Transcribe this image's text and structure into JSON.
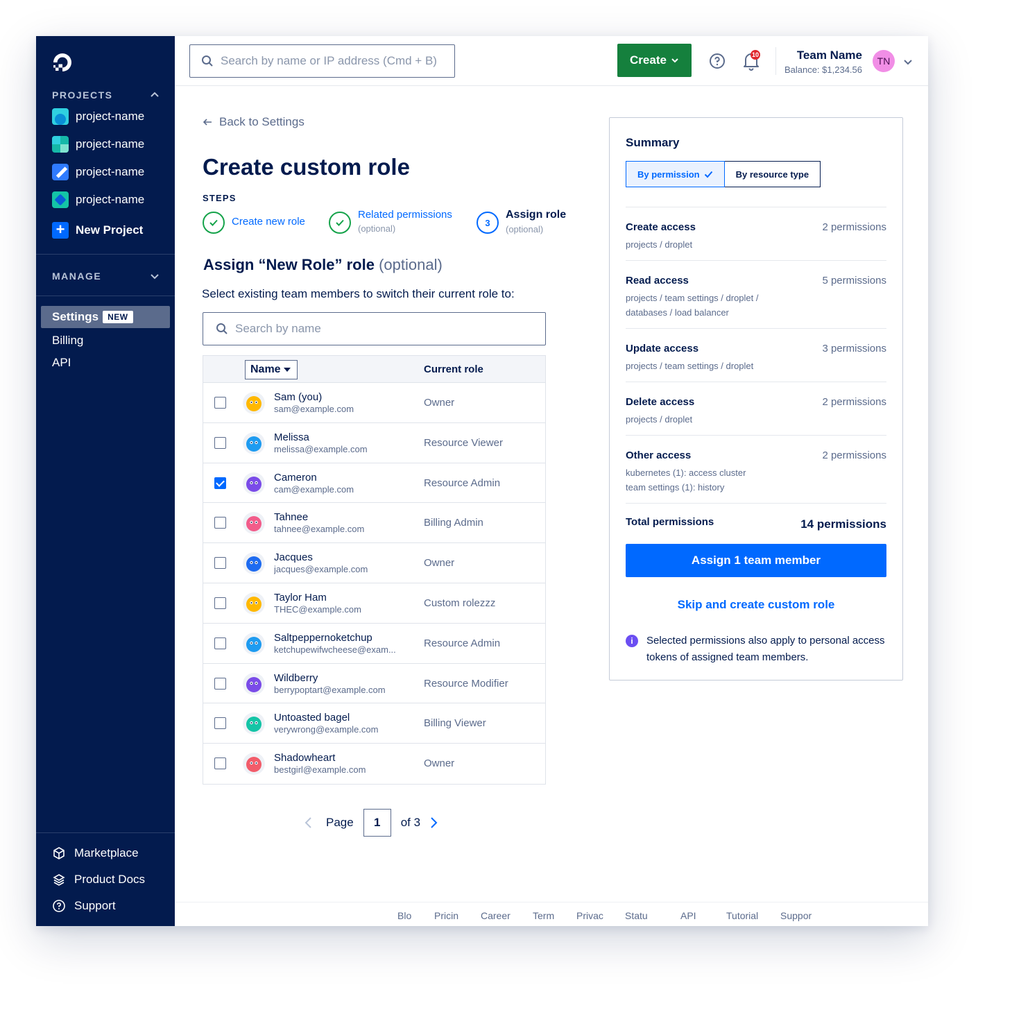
{
  "sidebar": {
    "projects_heading": "PROJECTS",
    "projects": [
      {
        "label": "project-name",
        "color": "#2fd0e0"
      },
      {
        "label": "project-name",
        "color": "#16b8a8"
      },
      {
        "label": "project-name",
        "color": "#2f7bff"
      },
      {
        "label": "project-name",
        "color": "#14c4a6"
      }
    ],
    "new_project": "New Project",
    "manage_heading": "MANAGE",
    "settings": "Settings",
    "settings_badge": "NEW",
    "billing": "Billing",
    "api": "API",
    "bottom": [
      {
        "label": "Marketplace",
        "icon": "cube-icon"
      },
      {
        "label": "Product Docs",
        "icon": "layers-icon"
      },
      {
        "label": "Support",
        "icon": "help-circle-icon"
      }
    ]
  },
  "topbar": {
    "search_placeholder": "Search by name or IP address (Cmd + B)",
    "create_label": "Create",
    "notification_count": "10",
    "team_name": "Team Name",
    "balance": "Balance: $1,234.56",
    "avatar_initials": "TN"
  },
  "main": {
    "back_label": "Back to Settings",
    "title": "Create custom role",
    "steps_label": "STEPS",
    "steps": [
      {
        "label": "Create new role",
        "sub": "",
        "state": "done"
      },
      {
        "label": "Related permissions",
        "sub": "(optional)",
        "state": "done"
      },
      {
        "label": "Assign role",
        "sub": "(optional)",
        "state": "current",
        "number": "3"
      }
    ],
    "assign_title": "Assign “New Role” role",
    "assign_title_opt": "(optional)",
    "assign_sub": "Select existing team members to switch their current role to:",
    "member_search_placeholder": "Search by name",
    "table": {
      "col_name": "Name",
      "col_role": "Current role",
      "rows": [
        {
          "name": "Sam (you)",
          "email": "sam@example.com",
          "role": "Owner",
          "checked": false,
          "avatar_color": "#ffb800"
        },
        {
          "name": "Melissa",
          "email": "melissa@example.com",
          "role": "Resource Viewer",
          "checked": false,
          "avatar_color": "#1e9bf0"
        },
        {
          "name": "Cameron",
          "email": "cam@example.com",
          "role": "Resource Admin",
          "checked": true,
          "avatar_color": "#7a4be8"
        },
        {
          "name": "Tahnee",
          "email": "tahnee@example.com",
          "role": "Billing Admin",
          "checked": false,
          "avatar_color": "#f25c8a"
        },
        {
          "name": "Jacques",
          "email": "jacques@example.com",
          "role": "Owner",
          "checked": false,
          "avatar_color": "#1e6bf0"
        },
        {
          "name": "Taylor Ham",
          "email": "THEC@example.com",
          "role": "Custom rolezzz",
          "checked": false,
          "avatar_color": "#ffb800"
        },
        {
          "name": "Saltpeppernoketchup",
          "email": "ketchupewifwcheese@exam...",
          "role": "Resource Admin",
          "checked": false,
          "avatar_color": "#1e9bf0"
        },
        {
          "name": "Wildberry",
          "email": "berrypoptart@example.com",
          "role": "Resource Modifier",
          "checked": false,
          "avatar_color": "#7a4be8"
        },
        {
          "name": "Untoasted bagel",
          "email": "verywrong@example.com",
          "role": "Billing Viewer",
          "checked": false,
          "avatar_color": "#14c4a6"
        },
        {
          "name": "Shadowheart",
          "email": "bestgirl@example.com",
          "role": "Owner",
          "checked": false,
          "avatar_color": "#f25c6a"
        }
      ]
    },
    "pager": {
      "page_label": "Page",
      "current": "1",
      "of_label": "of 3"
    }
  },
  "summary": {
    "title": "Summary",
    "tab_permission": "By permission",
    "tab_resource": "By resource type",
    "sections": [
      {
        "heading": "Create access",
        "count": "2 permissions",
        "detail": "projects / droplet"
      },
      {
        "heading": "Read access",
        "count": "5 permissions",
        "detail": "projects / team settings / droplet / databases / load balancer"
      },
      {
        "heading": "Update access",
        "count": "3 permissions",
        "detail": "projects / team settings / droplet"
      },
      {
        "heading": "Delete access",
        "count": "2 permissions",
        "detail": "projects / droplet"
      },
      {
        "heading": "Other access",
        "count": "2 permissions",
        "detail_lines": [
          "kubernetes (1): access cluster",
          "team settings (1): history"
        ]
      }
    ],
    "total_label": "Total permissions",
    "total_value": "14 permissions",
    "assign_button": "Assign 1 team member",
    "skip_link": "Skip and create custom role",
    "note": "Selected permissions also apply to personal access tokens of assigned team members."
  },
  "footer": [
    "Blo",
    "Pricin",
    "Career",
    "Term",
    "Privac",
    "Statu",
    "API",
    "Tutorial",
    "Suppor"
  ],
  "colors": {
    "sidebar_bg": "#031b4e",
    "primary": "#0069ff",
    "create_green": "#15803d"
  }
}
